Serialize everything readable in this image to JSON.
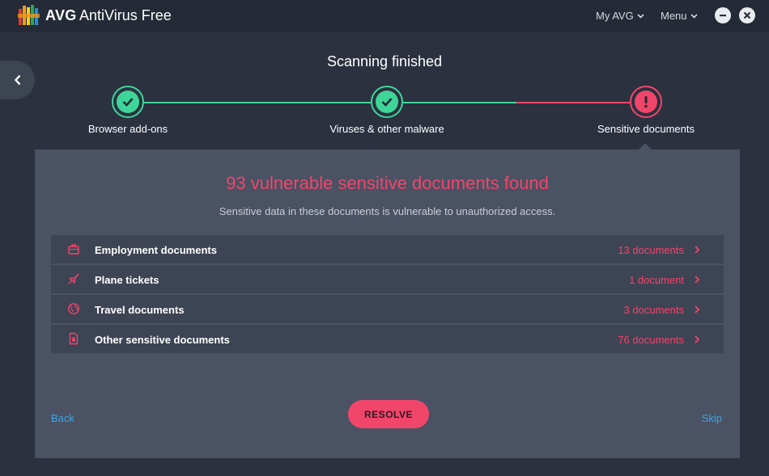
{
  "app": {
    "brand": "AVG",
    "product": "AntiVirus Free",
    "nav": {
      "my_avg": "My AVG",
      "menu": "Menu"
    }
  },
  "scan": {
    "title": "Scanning finished",
    "steps": [
      {
        "label": "Browser add-ons",
        "status": "ok"
      },
      {
        "label": "Viruses & other malware",
        "status": "ok"
      },
      {
        "label": "Sensitive documents",
        "status": "alert"
      }
    ]
  },
  "result": {
    "headline": "93 vulnerable sensitive documents found",
    "subline": "Sensitive data in these documents is vulnerable to unauthorized access.",
    "categories": [
      {
        "name": "Employment documents",
        "count": "13 documents",
        "icon": "briefcase-icon"
      },
      {
        "name": "Plane tickets",
        "count": "1 document",
        "icon": "plane-icon"
      },
      {
        "name": "Travel documents",
        "count": "3 documents",
        "icon": "globe-icon"
      },
      {
        "name": "Other sensitive documents",
        "count": "76 documents",
        "icon": "document-lock-icon"
      }
    ]
  },
  "actions": {
    "back": "Back",
    "resolve": "RESOLVE",
    "skip": "Skip"
  },
  "colors": {
    "accent_red": "#f2456a",
    "success_green": "#3ed598",
    "link_blue": "#3ea4e8",
    "panel": "#4a5263",
    "background": "#2b313f"
  }
}
